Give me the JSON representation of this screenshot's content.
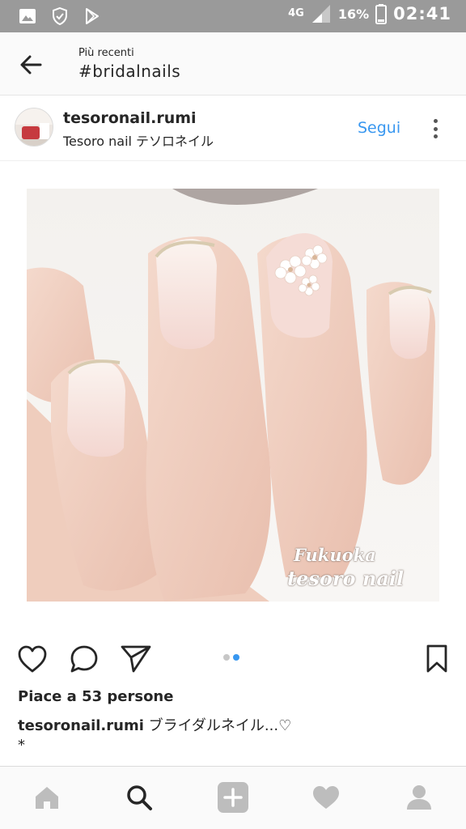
{
  "status_bar": {
    "network": "4G",
    "battery": "16%",
    "time": "02:41",
    "icons": [
      "gallery-icon",
      "shield-icon",
      "play-store-icon",
      "signal-icon",
      "battery-icon"
    ]
  },
  "header": {
    "subtitle": "Più recenti",
    "title": "#bridalnails"
  },
  "post": {
    "username": "tesoronail.rumi",
    "location": "Tesoro nail テソロネイル",
    "follow_label": "Segui",
    "watermark_line1": "Fukuoka",
    "watermark_line2": "tesoro nail",
    "carousel": {
      "count": 2,
      "active": 2
    },
    "likes": "Piace a 53 persone",
    "caption_user": "tesoronail.rumi",
    "caption_text": "ブライダルネイル...♡",
    "caption_line2": "*"
  },
  "colors": {
    "accent": "#3897f0",
    "status_bar": "#9a9a9a",
    "text": "#262626",
    "nav_icons": "#bdbdbd",
    "nav_active": "#262626"
  },
  "bottom_nav": [
    "home-icon",
    "search-icon",
    "add-icon",
    "heart-icon",
    "profile-icon"
  ]
}
